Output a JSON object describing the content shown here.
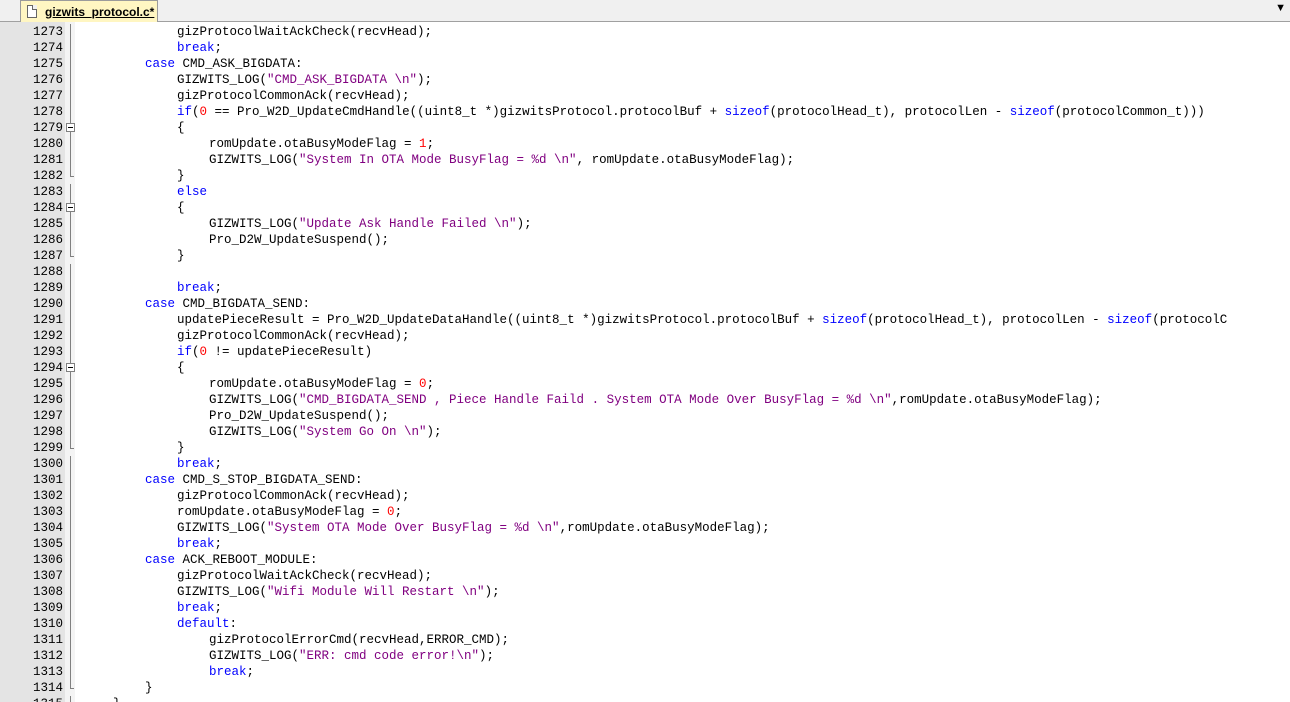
{
  "tab": {
    "title": "gizwits_protocol.c*",
    "menu_glyph": "▼"
  },
  "lines": [
    {
      "n": "1273",
      "fold": "line",
      "indent": 3,
      "tokens": [
        {
          "t": "gizProtocolWaitAckCheck(recvHead);",
          "c": ""
        }
      ]
    },
    {
      "n": "1274",
      "fold": "line",
      "indent": 3,
      "tokens": [
        {
          "t": "break",
          "c": "kw"
        },
        {
          "t": ";",
          "c": ""
        }
      ]
    },
    {
      "n": "1275",
      "fold": "line",
      "indent": 2,
      "tokens": [
        {
          "t": "case",
          "c": "kw"
        },
        {
          "t": " CMD_ASK_BIGDATA:",
          "c": ""
        }
      ]
    },
    {
      "n": "1276",
      "fold": "line",
      "indent": 3,
      "tokens": [
        {
          "t": "GIZWITS_LOG(",
          "c": ""
        },
        {
          "t": "\"CMD_ASK_BIGDATA \\n\"",
          "c": "str"
        },
        {
          "t": ");",
          "c": ""
        }
      ]
    },
    {
      "n": "1277",
      "fold": "line",
      "indent": 3,
      "tokens": [
        {
          "t": "gizProtocolCommonAck(recvHead);",
          "c": ""
        }
      ]
    },
    {
      "n": "1278",
      "fold": "line",
      "indent": 3,
      "tokens": [
        {
          "t": "if",
          "c": "kw"
        },
        {
          "t": "(",
          "c": ""
        },
        {
          "t": "0",
          "c": "num"
        },
        {
          "t": " == Pro_W2D_UpdateCmdHandle((uint8_t *)gizwitsProtocol.protocolBuf + ",
          "c": ""
        },
        {
          "t": "sizeof",
          "c": "kw"
        },
        {
          "t": "(protocolHead_t), protocolLen - ",
          "c": ""
        },
        {
          "t": "sizeof",
          "c": "kw"
        },
        {
          "t": "(protocolCommon_t)))",
          "c": ""
        }
      ]
    },
    {
      "n": "1279",
      "fold": "box",
      "indent": 3,
      "tokens": [
        {
          "t": "{",
          "c": ""
        }
      ]
    },
    {
      "n": "1280",
      "fold": "line",
      "indent": 4,
      "tokens": [
        {
          "t": "romUpdate.otaBusyModeFlag = ",
          "c": ""
        },
        {
          "t": "1",
          "c": "num"
        },
        {
          "t": ";",
          "c": ""
        }
      ]
    },
    {
      "n": "1281",
      "fold": "line",
      "indent": 4,
      "tokens": [
        {
          "t": "GIZWITS_LOG(",
          "c": ""
        },
        {
          "t": "\"System In OTA Mode BusyFlag = %d \\n\"",
          "c": "str"
        },
        {
          "t": ", romUpdate.otaBusyModeFlag);",
          "c": ""
        }
      ]
    },
    {
      "n": "1282",
      "fold": "end",
      "indent": 3,
      "tokens": [
        {
          "t": "}",
          "c": ""
        }
      ]
    },
    {
      "n": "1283",
      "fold": "line",
      "indent": 3,
      "tokens": [
        {
          "t": "else",
          "c": "kw"
        }
      ]
    },
    {
      "n": "1284",
      "fold": "box",
      "indent": 3,
      "tokens": [
        {
          "t": "{",
          "c": ""
        }
      ]
    },
    {
      "n": "1285",
      "fold": "line",
      "indent": 4,
      "tokens": [
        {
          "t": "GIZWITS_LOG(",
          "c": ""
        },
        {
          "t": "\"Update Ask Handle Failed \\n\"",
          "c": "str"
        },
        {
          "t": ");",
          "c": ""
        }
      ]
    },
    {
      "n": "1286",
      "fold": "line",
      "indent": 4,
      "tokens": [
        {
          "t": "Pro_D2W_UpdateSuspend();",
          "c": ""
        }
      ]
    },
    {
      "n": "1287",
      "fold": "end",
      "indent": 3,
      "tokens": [
        {
          "t": "}",
          "c": ""
        }
      ]
    },
    {
      "n": "1288",
      "fold": "line",
      "indent": 0,
      "tokens": []
    },
    {
      "n": "1289",
      "fold": "line",
      "indent": 3,
      "tokens": [
        {
          "t": "break",
          "c": "kw"
        },
        {
          "t": ";",
          "c": ""
        }
      ]
    },
    {
      "n": "1290",
      "fold": "line",
      "indent": 2,
      "tokens": [
        {
          "t": "case",
          "c": "kw"
        },
        {
          "t": " CMD_BIGDATA_SEND:",
          "c": ""
        }
      ]
    },
    {
      "n": "1291",
      "fold": "line",
      "indent": 3,
      "tokens": [
        {
          "t": "updatePieceResult = Pro_W2D_UpdateDataHandle((uint8_t *)gizwitsProtocol.protocolBuf + ",
          "c": ""
        },
        {
          "t": "sizeof",
          "c": "kw"
        },
        {
          "t": "(protocolHead_t), protocolLen - ",
          "c": ""
        },
        {
          "t": "sizeof",
          "c": "kw"
        },
        {
          "t": "(protocolC",
          "c": ""
        }
      ]
    },
    {
      "n": "1292",
      "fold": "line",
      "indent": 3,
      "tokens": [
        {
          "t": "gizProtocolCommonAck(recvHead);",
          "c": ""
        }
      ]
    },
    {
      "n": "1293",
      "fold": "line",
      "indent": 3,
      "tokens": [
        {
          "t": "if",
          "c": "kw"
        },
        {
          "t": "(",
          "c": ""
        },
        {
          "t": "0",
          "c": "num"
        },
        {
          "t": " != updatePieceResult)",
          "c": ""
        }
      ]
    },
    {
      "n": "1294",
      "fold": "box",
      "indent": 3,
      "tokens": [
        {
          "t": "{",
          "c": ""
        }
      ]
    },
    {
      "n": "1295",
      "fold": "line",
      "indent": 4,
      "tokens": [
        {
          "t": "romUpdate.otaBusyModeFlag = ",
          "c": ""
        },
        {
          "t": "0",
          "c": "num"
        },
        {
          "t": ";",
          "c": ""
        }
      ]
    },
    {
      "n": "1296",
      "fold": "line",
      "indent": 4,
      "tokens": [
        {
          "t": "GIZWITS_LOG(",
          "c": ""
        },
        {
          "t": "\"CMD_BIGDATA_SEND , Piece Handle Faild . System OTA Mode Over BusyFlag = %d \\n\"",
          "c": "str"
        },
        {
          "t": ",romUpdate.otaBusyModeFlag);",
          "c": ""
        }
      ]
    },
    {
      "n": "1297",
      "fold": "line",
      "indent": 4,
      "tokens": [
        {
          "t": "Pro_D2W_UpdateSuspend();",
          "c": ""
        }
      ]
    },
    {
      "n": "1298",
      "fold": "line",
      "indent": 4,
      "tokens": [
        {
          "t": "GIZWITS_LOG(",
          "c": ""
        },
        {
          "t": "\"System Go On \\n\"",
          "c": "str"
        },
        {
          "t": ");",
          "c": ""
        }
      ]
    },
    {
      "n": "1299",
      "fold": "end",
      "indent": 3,
      "tokens": [
        {
          "t": "}",
          "c": ""
        }
      ]
    },
    {
      "n": "1300",
      "fold": "line",
      "indent": 3,
      "tokens": [
        {
          "t": "break",
          "c": "kw"
        },
        {
          "t": ";",
          "c": ""
        }
      ]
    },
    {
      "n": "1301",
      "fold": "line",
      "indent": 2,
      "tokens": [
        {
          "t": "case",
          "c": "kw"
        },
        {
          "t": " CMD_S_STOP_BIGDATA_SEND:",
          "c": ""
        }
      ]
    },
    {
      "n": "1302",
      "fold": "line",
      "indent": 3,
      "tokens": [
        {
          "t": "gizProtocolCommonAck(recvHead);",
          "c": ""
        }
      ]
    },
    {
      "n": "1303",
      "fold": "line",
      "indent": 3,
      "tokens": [
        {
          "t": "romUpdate.otaBusyModeFlag = ",
          "c": ""
        },
        {
          "t": "0",
          "c": "num"
        },
        {
          "t": ";",
          "c": ""
        }
      ]
    },
    {
      "n": "1304",
      "fold": "line",
      "indent": 3,
      "tokens": [
        {
          "t": "GIZWITS_LOG(",
          "c": ""
        },
        {
          "t": "\"System OTA Mode Over BusyFlag = %d \\n\"",
          "c": "str"
        },
        {
          "t": ",romUpdate.otaBusyModeFlag);",
          "c": ""
        }
      ]
    },
    {
      "n": "1305",
      "fold": "line",
      "indent": 3,
      "tokens": [
        {
          "t": "break",
          "c": "kw"
        },
        {
          "t": ";",
          "c": ""
        }
      ]
    },
    {
      "n": "1306",
      "fold": "line",
      "indent": 2,
      "tokens": [
        {
          "t": "case",
          "c": "kw"
        },
        {
          "t": " ACK_REBOOT_MODULE:",
          "c": ""
        }
      ]
    },
    {
      "n": "1307",
      "fold": "line",
      "indent": 3,
      "tokens": [
        {
          "t": "gizProtocolWaitAckCheck(recvHead);",
          "c": ""
        }
      ]
    },
    {
      "n": "1308",
      "fold": "line",
      "indent": 3,
      "tokens": [
        {
          "t": "GIZWITS_LOG(",
          "c": ""
        },
        {
          "t": "\"Wifi Module Will Restart \\n\"",
          "c": "str"
        },
        {
          "t": ");",
          "c": ""
        }
      ]
    },
    {
      "n": "1309",
      "fold": "line",
      "indent": 3,
      "tokens": [
        {
          "t": "break",
          "c": "kw"
        },
        {
          "t": ";",
          "c": ""
        }
      ]
    },
    {
      "n": "1310",
      "fold": "line",
      "indent": 3,
      "tokens": [
        {
          "t": "default",
          "c": "kw"
        },
        {
          "t": ":",
          "c": ""
        }
      ]
    },
    {
      "n": "1311",
      "fold": "line",
      "indent": 4,
      "tokens": [
        {
          "t": "gizProtocolErrorCmd(recvHead,ERROR_CMD);",
          "c": ""
        }
      ]
    },
    {
      "n": "1312",
      "fold": "line",
      "indent": 4,
      "tokens": [
        {
          "t": "GIZWITS_LOG(",
          "c": ""
        },
        {
          "t": "\"ERR: cmd code error!\\n\"",
          "c": "str"
        },
        {
          "t": ");",
          "c": ""
        }
      ]
    },
    {
      "n": "1313",
      "fold": "line",
      "indent": 4,
      "tokens": [
        {
          "t": "break",
          "c": "kw"
        },
        {
          "t": ";",
          "c": ""
        }
      ]
    },
    {
      "n": "1314",
      "fold": "end",
      "indent": 2,
      "tokens": [
        {
          "t": "}",
          "c": ""
        }
      ]
    },
    {
      "n": "1315",
      "fold": "end",
      "indent": 1,
      "tokens": [
        {
          "t": "}",
          "c": ""
        }
      ]
    }
  ]
}
